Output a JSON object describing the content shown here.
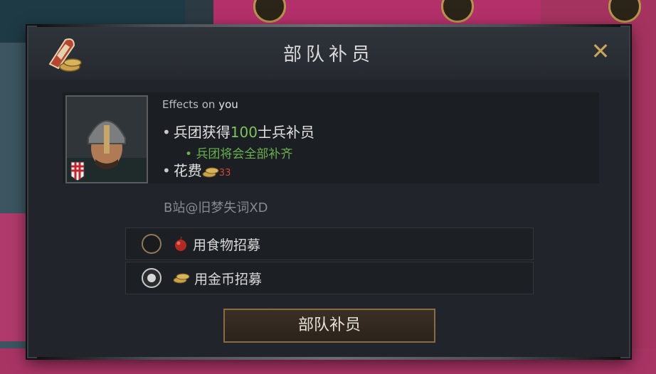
{
  "dialog": {
    "title": "部队补员",
    "close_glyph": "✕"
  },
  "effects": {
    "heading_prefix": "Effects on ",
    "heading_target": "you",
    "bullet": "•",
    "line1_prefix": "兵团获得",
    "line1_value": "100",
    "line1_suffix": "士兵补员",
    "line2": "兵团将会全部补齐",
    "cost_label": "花费",
    "cost_value": "33"
  },
  "watermark": "B站@旧梦失词XD",
  "options": [
    {
      "label": "用食物招募",
      "icon": "apple-icon",
      "selected": false
    },
    {
      "label": "用金币招募",
      "icon": "coins-icon",
      "selected": true
    }
  ],
  "confirm_label": "部队补员",
  "colors": {
    "positive": "#7cc35a",
    "cost": "#d6453b",
    "accent_gold": "#c9a55b"
  }
}
